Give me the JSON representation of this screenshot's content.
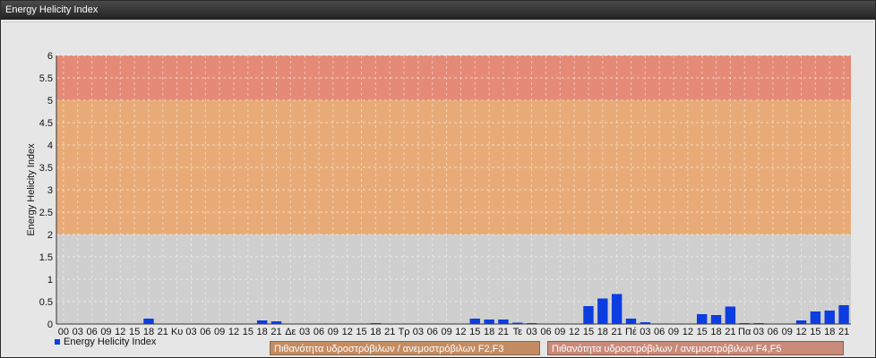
{
  "window": {
    "title": "Energy Helicity Index"
  },
  "legend": {
    "series_label": "Energy Helicity Index"
  },
  "bands": [
    {
      "label": "Πιθανότητα υδροστρόβιλων / ανεμοστρόβιλων F2,F3",
      "from": 2,
      "to": 5,
      "color": "#e8a46a"
    },
    {
      "label": "Πιθανότητα υδροστρόβιλων / ανεμοστρόβιλων F4,F5",
      "from": 5,
      "to": 6,
      "color": "#e47f6a"
    }
  ],
  "colors": {
    "bar": "#0b3de0",
    "lowzone": "#cfcfcf",
    "background": "#e6e6e6"
  },
  "chart_data": {
    "type": "bar",
    "title": "",
    "ylabel": "Energy Helicity Index",
    "xlabel": "",
    "ylim": [
      0,
      6
    ],
    "yticks": [
      0,
      0.5,
      1,
      1.5,
      2,
      2.5,
      3,
      3.5,
      4,
      4.5,
      5,
      5.5,
      6
    ],
    "grid": true,
    "legend_position": "bottom-left",
    "categories": [
      "00",
      "03",
      "06",
      "09",
      "12",
      "15",
      "18",
      "21",
      "Κυ",
      "03",
      "06",
      "09",
      "12",
      "15",
      "18",
      "21",
      "Δε",
      "03",
      "06",
      "09",
      "12",
      "15",
      "18",
      "21",
      "Τρ",
      "03",
      "06",
      "09",
      "12",
      "15",
      "18",
      "21",
      "Τε",
      "03",
      "06",
      "09",
      "12",
      "15",
      "18",
      "21",
      "Πέ",
      "03",
      "06",
      "09",
      "12",
      "15",
      "18",
      "21",
      "Πα",
      "03",
      "06",
      "09",
      "12",
      "15",
      "18",
      "21"
    ],
    "series": [
      {
        "name": "Energy Helicity Index",
        "values": [
          0.01,
          0.01,
          0.01,
          0.01,
          0.01,
          0.01,
          0.12,
          0.01,
          0.01,
          0.01,
          0.01,
          0.01,
          0.01,
          0.01,
          0.08,
          0.06,
          0.01,
          0.01,
          0.01,
          0.01,
          0.01,
          0.01,
          0.02,
          0.01,
          0.01,
          0.01,
          0.01,
          0.01,
          0.01,
          0.12,
          0.1,
          0.1,
          0.03,
          0.02,
          0.01,
          0.01,
          0.01,
          0.4,
          0.57,
          0.67,
          0.12,
          0.04,
          0.01,
          0.01,
          0.01,
          0.22,
          0.2,
          0.39,
          0.02,
          0.02,
          0.01,
          0.01,
          0.08,
          0.28,
          0.3,
          0.42
        ]
      }
    ]
  }
}
